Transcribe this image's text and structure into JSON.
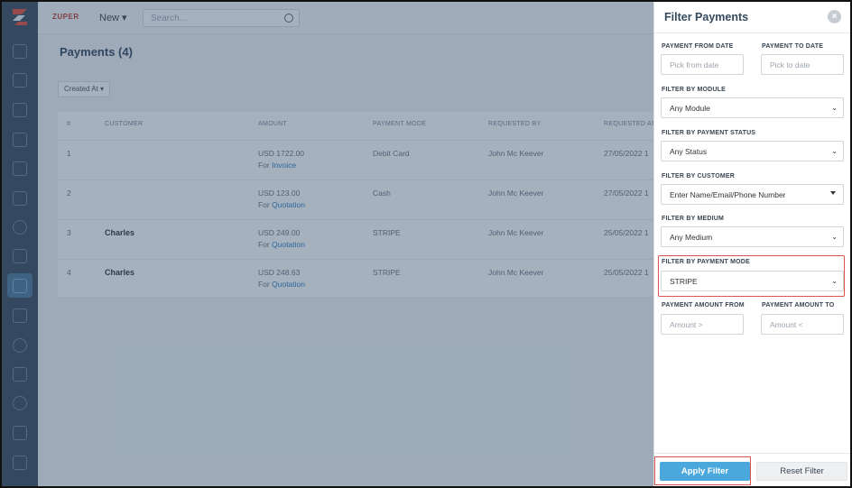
{
  "topbar": {
    "brand": "ZUPER",
    "new_label": "New ▾",
    "search_placeholder": "Search..."
  },
  "page": {
    "title": "Payments (4)",
    "sort_button": "Created At ▾"
  },
  "table": {
    "headers": [
      "#",
      "CUSTOMER",
      "AMOUNT",
      "PAYMENT MODE",
      "REQUESTED BY",
      "REQUESTED AT"
    ],
    "rows": [
      {
        "num": "1",
        "customer": "",
        "amount": "USD 1722.00",
        "for_prefix": "For",
        "for_link": "Invoice",
        "mode": "Debit Card",
        "by": "John Mc Keever",
        "at": "27/05/2022 1"
      },
      {
        "num": "2",
        "customer": "",
        "amount": "USD 123.00",
        "for_prefix": "For",
        "for_link": "Quotation",
        "mode": "Cash",
        "by": "John Mc Keever",
        "at": "27/05/2022 1"
      },
      {
        "num": "3",
        "customer": "Charles",
        "amount": "USD 249.00",
        "for_prefix": "For",
        "for_link": "Quotation",
        "mode": "STRIPE",
        "by": "John Mc Keever",
        "at": "25/05/2022 1"
      },
      {
        "num": "4",
        "customer": "Charles",
        "amount": "USD 248.63",
        "for_prefix": "For",
        "for_link": "Quotation",
        "mode": "STRIPE",
        "by": "John Mc Keever",
        "at": "25/05/2022 1"
      }
    ]
  },
  "filter": {
    "title": "Filter Payments",
    "from_date_label": "PAYMENT FROM DATE",
    "from_date_placeholder": "Pick from date",
    "to_date_label": "PAYMENT TO DATE",
    "to_date_placeholder": "Pick to date",
    "module_label": "FILTER BY MODULE",
    "module_value": "Any Module",
    "status_label": "FILTER BY PAYMENT STATUS",
    "status_value": "Any Status",
    "customer_label": "FILTER BY CUSTOMER",
    "customer_placeholder": "Enter Name/Email/Phone Number",
    "medium_label": "FILTER BY MEDIUM",
    "medium_value": "Any Medium",
    "mode_label": "FILTER BY PAYMENT MODE",
    "mode_value": "STRIPE",
    "amount_from_label": "PAYMENT AMOUNT FROM",
    "amount_from_placeholder": "Amount >",
    "amount_to_label": "PAYMENT AMOUNT TO",
    "amount_to_placeholder": "Amount <",
    "apply_label": "Apply Filter",
    "reset_label": "Reset Filter"
  },
  "colors": {
    "accent": "#4aa8dc",
    "highlight": "#d9534f",
    "rail": "#3c4b5d"
  }
}
